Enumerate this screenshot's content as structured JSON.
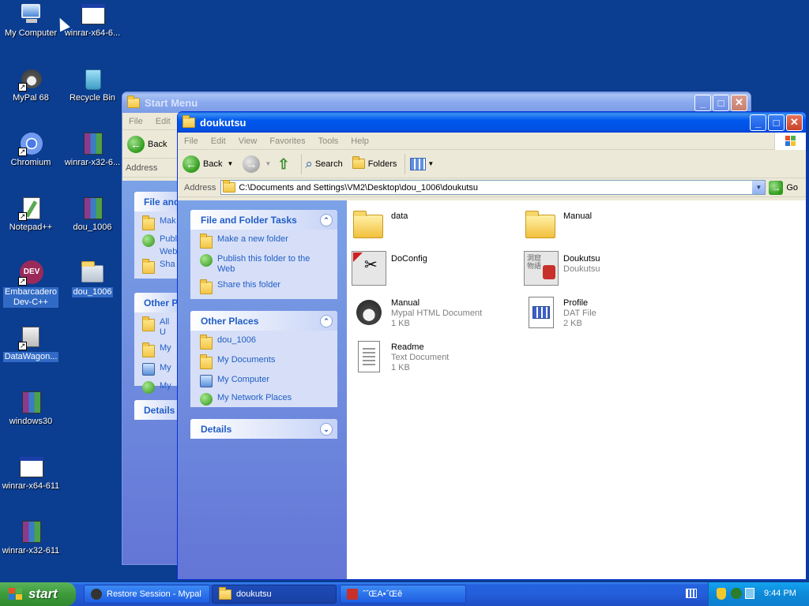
{
  "desktop": {
    "icons": [
      {
        "label": "My Computer"
      },
      {
        "label": "winrar-x64-6..."
      },
      {
        "label": "MyPal 68"
      },
      {
        "label": "Recycle Bin"
      },
      {
        "label": "Chromium"
      },
      {
        "label": "winrar-x32-6..."
      },
      {
        "label": "Notepad++"
      },
      {
        "label": "dou_1006"
      },
      {
        "label": "Embarcadero\nDev-C++"
      },
      {
        "label": "dou_1006"
      },
      {
        "label": "DataWagon..."
      },
      {
        "label": "windows30"
      },
      {
        "label": "winrar-x64-611"
      },
      {
        "label": "winrar-x32-611"
      }
    ]
  },
  "back_window": {
    "title": "Start Menu",
    "menu": [
      "File",
      "Edit"
    ],
    "back_label": "Back",
    "address_label": "Address",
    "panels": [
      "File and",
      "Other P",
      "Details"
    ],
    "items1": [
      "Mak",
      "Publ",
      "Web",
      "Sha"
    ],
    "items2": [
      "All U",
      "My",
      "My",
      "My"
    ]
  },
  "explorer": {
    "title": "doukutsu",
    "menu": [
      "File",
      "Edit",
      "View",
      "Favorites",
      "Tools",
      "Help"
    ],
    "toolbar": {
      "back": "Back",
      "search": "Search",
      "folders": "Folders"
    },
    "address": {
      "label": "Address",
      "value": "C:\\Documents and Settings\\VM2\\Desktop\\dou_1006\\doukutsu",
      "go": "Go"
    },
    "tasks": {
      "title": "File and Folder Tasks",
      "items": [
        "Make a new folder",
        "Publish this folder to the Web",
        "Share this folder"
      ]
    },
    "other_places": {
      "title": "Other Places",
      "items": [
        "dou_1006",
        "My Documents",
        "My Computer",
        "My Network Places"
      ]
    },
    "details": {
      "title": "Details"
    },
    "files": [
      {
        "name": "data",
        "type": "",
        "size": "",
        "icon": "folder-icon"
      },
      {
        "name": "Manual",
        "type": "",
        "size": "",
        "icon": "folder-icon"
      },
      {
        "name": "DoConfig",
        "type": "",
        "size": "",
        "icon": "config-app-icon"
      },
      {
        "name": "Doukutsu",
        "type": "Doukutsu",
        "size": "",
        "icon": "game-app-icon"
      },
      {
        "name": "Manual",
        "type": "Mypal HTML Document",
        "size": "1 KB",
        "icon": "html-document-icon"
      },
      {
        "name": "Profile",
        "type": "DAT File",
        "size": "2 KB",
        "icon": "dat-file-icon"
      },
      {
        "name": "Readme",
        "type": "Text Document",
        "size": "1 KB",
        "icon": "text-document-icon"
      }
    ]
  },
  "taskbar": {
    "start": "start",
    "items": [
      "Restore Session - Mypal",
      "doukutsu",
      "ˆ˝ŒA•˝Œê"
    ],
    "clock": "9:44 PM"
  }
}
